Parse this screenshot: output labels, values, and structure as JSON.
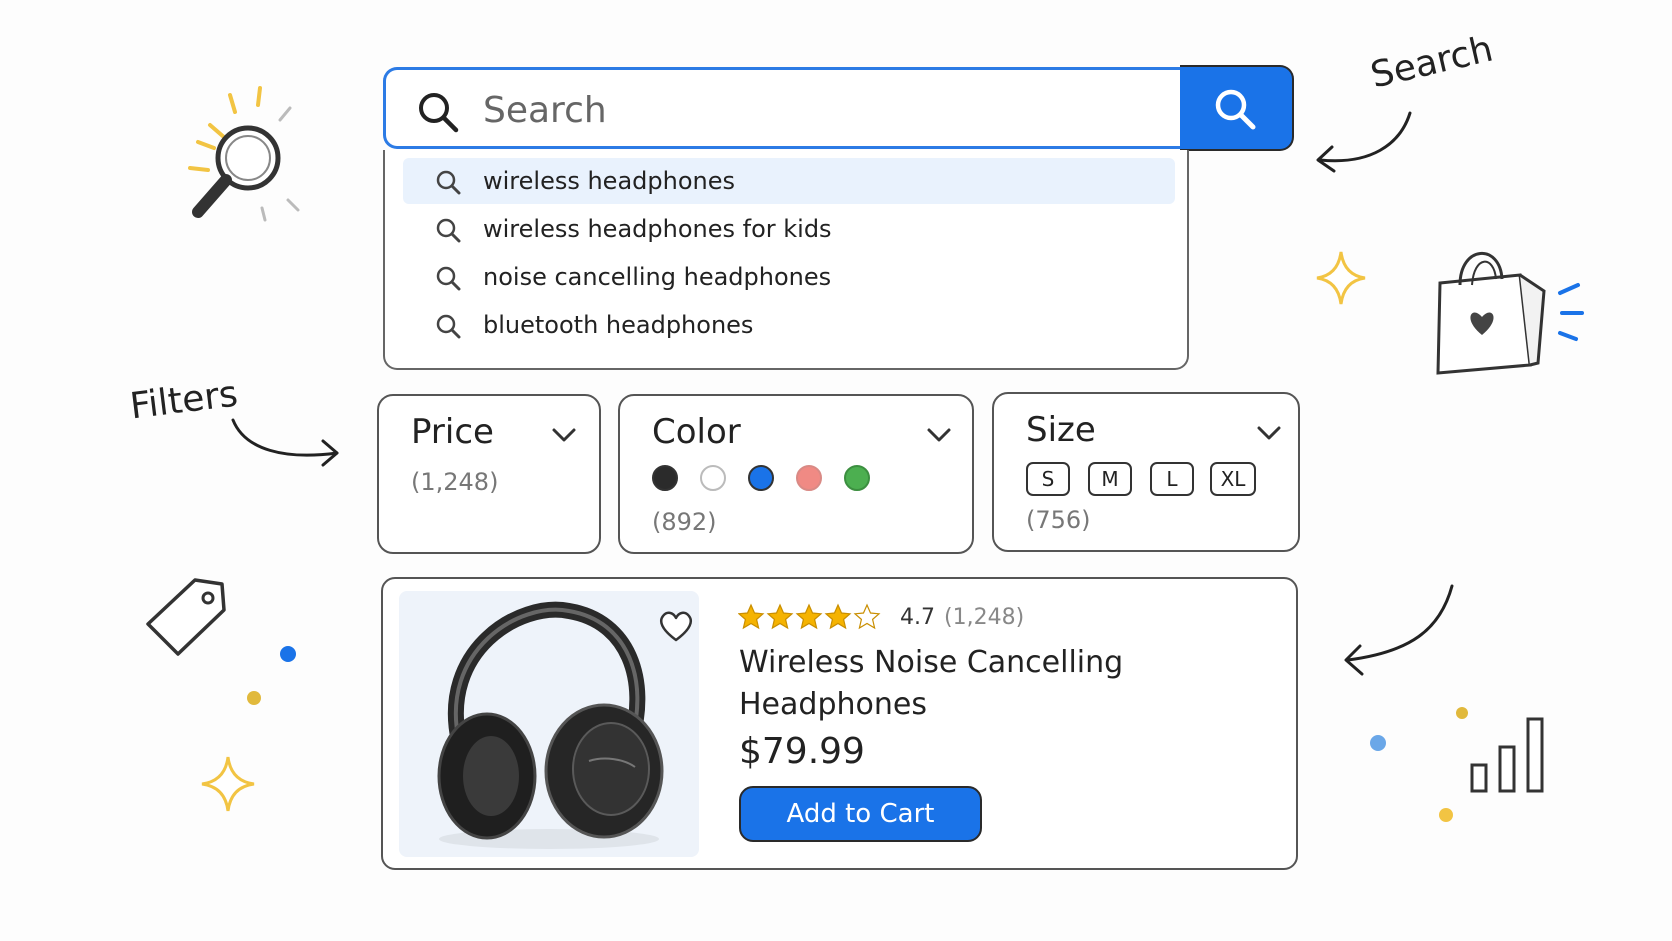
{
  "search": {
    "placeholder": "Search",
    "suggestions": [
      "wireless headphones",
      "wireless headphones for kids",
      "noise cancelling headphones",
      "bluetooth headphones"
    ]
  },
  "filters": {
    "price": {
      "title": "Price",
      "count": "(1,248)"
    },
    "color": {
      "title": "Color",
      "count": "(892)",
      "swatches": [
        "#2b2b2b",
        "#ffffff",
        "#1a73e8",
        "#f08a84",
        "#4caf50"
      ]
    },
    "size": {
      "title": "Size",
      "count": "(756)",
      "options": [
        "S",
        "M",
        "L",
        "XL"
      ]
    }
  },
  "product": {
    "rating": "4.7",
    "rating_stars": 4.5,
    "review_count": "(1,248)",
    "title": "Wireless Noise Cancelling Headphones",
    "price": "$79.99",
    "cta": "Add to Cart"
  },
  "annotations": {
    "search": "Search",
    "filters": "Filters"
  },
  "colors": {
    "accent": "#1a73e8",
    "star": "#f5b301",
    "sparkle": "#f2c443"
  }
}
